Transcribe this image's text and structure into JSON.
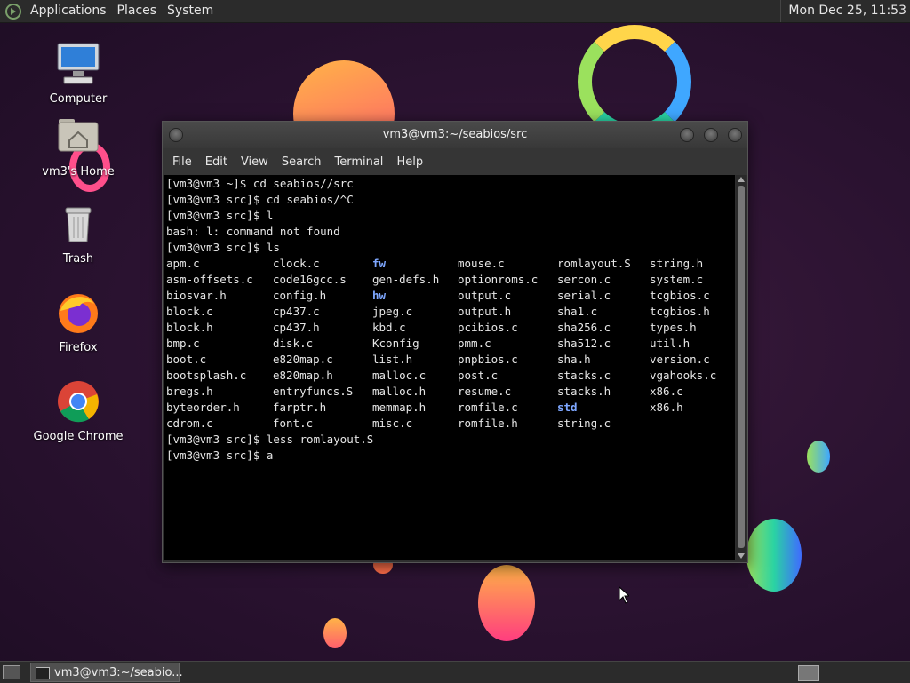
{
  "top_panel": {
    "menus": [
      "Applications",
      "Places",
      "System"
    ],
    "clock": "Mon Dec 25, 11:53"
  },
  "desktop_icons": [
    {
      "label": "Computer",
      "icon": "computer-icon"
    },
    {
      "label": "vm3's Home",
      "icon": "home-folder-icon"
    },
    {
      "label": "Trash",
      "icon": "trash-icon"
    },
    {
      "label": "Firefox",
      "icon": "firefox-icon"
    },
    {
      "label": "Google Chrome",
      "icon": "chrome-icon"
    }
  ],
  "window": {
    "title": "vm3@vm3:~/seabios/src",
    "menu": [
      "File",
      "Edit",
      "View",
      "Search",
      "Terminal",
      "Help"
    ]
  },
  "terminal": {
    "lines_before": [
      "[vm3@vm3 ~]$ cd seabios//src",
      "[vm3@vm3 src]$ cd seabios/^C",
      "[vm3@vm3 src]$ l",
      "bash: l: command not found",
      "[vm3@vm3 src]$ ls"
    ],
    "ls_rows": [
      [
        "apm.c",
        "clock.c",
        "fw",
        "mouse.c",
        "romlayout.S",
        "string.h"
      ],
      [
        "asm-offsets.c",
        "code16gcc.s",
        "gen-defs.h",
        "optionroms.c",
        "sercon.c",
        "system.c"
      ],
      [
        "biosvar.h",
        "config.h",
        "hw",
        "output.c",
        "serial.c",
        "tcgbios.c"
      ],
      [
        "block.c",
        "cp437.c",
        "jpeg.c",
        "output.h",
        "sha1.c",
        "tcgbios.h"
      ],
      [
        "block.h",
        "cp437.h",
        "kbd.c",
        "pcibios.c",
        "sha256.c",
        "types.h"
      ],
      [
        "bmp.c",
        "disk.c",
        "Kconfig",
        "pmm.c",
        "sha512.c",
        "util.h"
      ],
      [
        "boot.c",
        "e820map.c",
        "list.h",
        "pnpbios.c",
        "sha.h",
        "version.c"
      ],
      [
        "bootsplash.c",
        "e820map.h",
        "malloc.c",
        "post.c",
        "stacks.c",
        "vgahooks.c"
      ],
      [
        "bregs.h",
        "entryfuncs.S",
        "malloc.h",
        "resume.c",
        "stacks.h",
        "x86.c"
      ],
      [
        "byteorder.h",
        "farptr.h",
        "memmap.h",
        "romfile.c",
        "std",
        "x86.h"
      ],
      [
        "cdrom.c",
        "font.c",
        "misc.c",
        "romfile.h",
        "string.c",
        ""
      ]
    ],
    "directories": [
      "fw",
      "hw",
      "std"
    ],
    "lines_after": [
      "[vm3@vm3 src]$ less romlayout.S",
      "[vm3@vm3 src]$ a"
    ]
  },
  "taskbar": {
    "task_label": "vm3@vm3:~/seabio..."
  },
  "colors": {
    "dir_color": "#7ea7ff",
    "terminal_bg": "#000000",
    "panel_bg": "#2b2b2b"
  }
}
